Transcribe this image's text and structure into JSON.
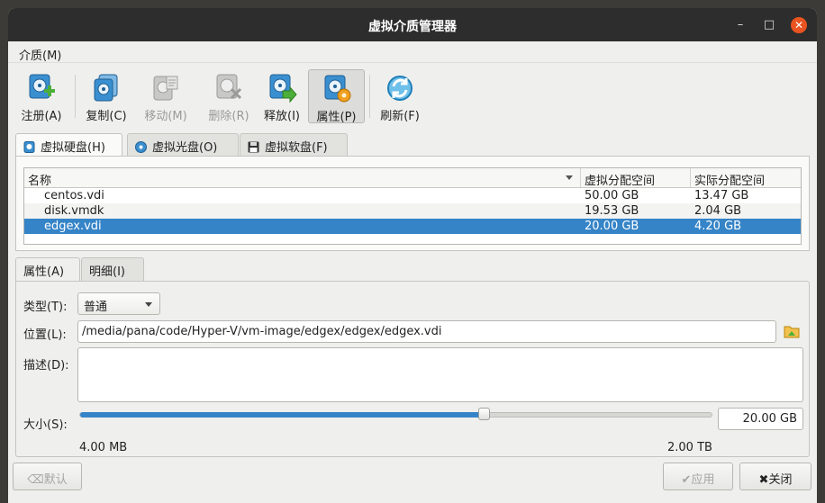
{
  "window": {
    "title": "虚拟介质管理器",
    "controls": {
      "minimize": "–",
      "maximize": "□",
      "close": "✕"
    }
  },
  "menubar": {
    "media": "介质(M)"
  },
  "toolbar": {
    "items": [
      {
        "label": "注册(A)",
        "icon": "disk-add-icon",
        "enabled": true
      },
      {
        "label": "复制(C)",
        "icon": "disk-copy-icon",
        "enabled": true
      },
      {
        "label": "移动(M)",
        "icon": "disk-move-icon",
        "enabled": false
      },
      {
        "label": "删除(R)",
        "icon": "disk-remove-icon",
        "enabled": false
      },
      {
        "label": "释放(I)",
        "icon": "disk-release-icon",
        "enabled": true
      },
      {
        "label": "属性(P)",
        "icon": "disk-properties-icon",
        "enabled": true,
        "active": true
      },
      {
        "label": "刷新(F)",
        "icon": "refresh-icon",
        "enabled": true
      }
    ]
  },
  "media_tabs": [
    {
      "label": "虚拟硬盘(H)",
      "selected": true
    },
    {
      "label": "虚拟光盘(O)",
      "selected": false
    },
    {
      "label": "虚拟软盘(F)",
      "selected": false
    }
  ],
  "table": {
    "columns": [
      "名称",
      "虚拟分配空间",
      "实际分配空间"
    ],
    "rows": [
      {
        "name": "centos.vdi",
        "virtual": "50.00 GB",
        "actual": "13.47 GB",
        "selected": false
      },
      {
        "name": "disk.vmdk",
        "virtual": "19.53 GB",
        "actual": "2.04 GB",
        "selected": false
      },
      {
        "name": "edgex.vdi",
        "virtual": "20.00 GB",
        "actual": "4.20 GB",
        "selected": true
      }
    ]
  },
  "detail_tabs": [
    {
      "label": "属性(A)",
      "selected": true
    },
    {
      "label": "明细(I)",
      "selected": false
    }
  ],
  "properties": {
    "type_label": "类型(T):",
    "type_value": "普通",
    "location_label": "位置(L):",
    "location_value": "/media/pana/code/Hyper-V/vm-image/edgex/edgex/edgex.vdi",
    "description_label": "描述(D):",
    "description_value": "",
    "size_label": "大小(S):",
    "size_value": "20.00 GB",
    "size_min": "4.00 MB",
    "size_max": "2.00 TB",
    "slider_fraction": 0.639
  },
  "buttons": {
    "reset": "默认",
    "apply": "应用",
    "close": "关闭"
  },
  "colors": {
    "selection": "#3584c8",
    "close_button": "#e95420",
    "titlebar": "#2d2d2d"
  }
}
